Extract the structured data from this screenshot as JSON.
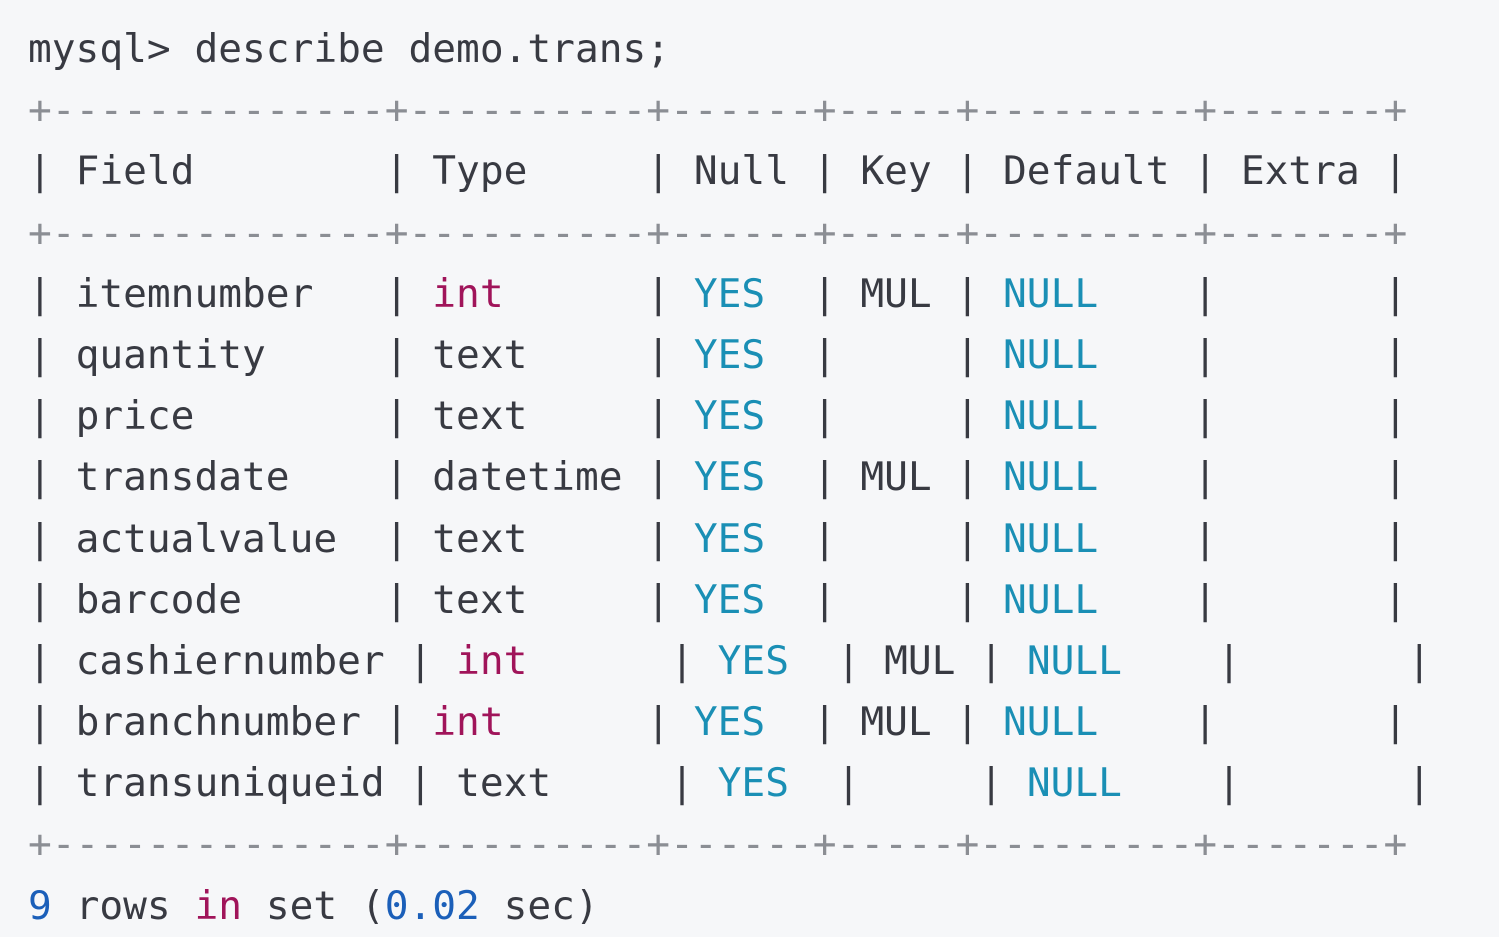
{
  "terminal": {
    "prompt": "mysql>",
    "command": " describe demo.trans;",
    "border_line": "+--------------+----------+------+-----+---------+-------+",
    "columns": [
      "Field",
      "Type",
      "Null",
      "Key",
      "Default",
      "Extra"
    ],
    "rows": [
      {
        "field": "itemnumber",
        "type": "int",
        "null": "YES",
        "key": "MUL",
        "default": "NULL",
        "extra": ""
      },
      {
        "field": "quantity",
        "type": "text",
        "null": "YES",
        "key": "",
        "default": "NULL",
        "extra": ""
      },
      {
        "field": "price",
        "type": "text",
        "null": "YES",
        "key": "",
        "default": "NULL",
        "extra": ""
      },
      {
        "field": "transdate",
        "type": "datetime",
        "null": "YES",
        "key": "MUL",
        "default": "NULL",
        "extra": ""
      },
      {
        "field": "actualvalue",
        "type": "text",
        "null": "YES",
        "key": "",
        "default": "NULL",
        "extra": ""
      },
      {
        "field": "barcode",
        "type": "text",
        "null": "YES",
        "key": "",
        "default": "NULL",
        "extra": ""
      },
      {
        "field": "cashiernumber",
        "type": "int",
        "null": "YES",
        "key": "MUL",
        "default": "NULL",
        "extra": ""
      },
      {
        "field": "branchnumber",
        "type": "int",
        "null": "YES",
        "key": "MUL",
        "default": "NULL",
        "extra": ""
      },
      {
        "field": "transuniqueid",
        "type": "text",
        "null": "YES",
        "key": "",
        "default": "NULL",
        "extra": ""
      }
    ],
    "footer": {
      "count": "9",
      "rows_word": "rows",
      "in_word": "in",
      "set_word": "set",
      "time_open": "(",
      "time_value": "0.02",
      "time_unit": "sec)"
    }
  },
  "colors": {
    "background": "#f6f7f9",
    "text": "#383a42",
    "keyword": "#a0145a",
    "literal": "#1a8fb5",
    "number": "#1b5fb9"
  }
}
